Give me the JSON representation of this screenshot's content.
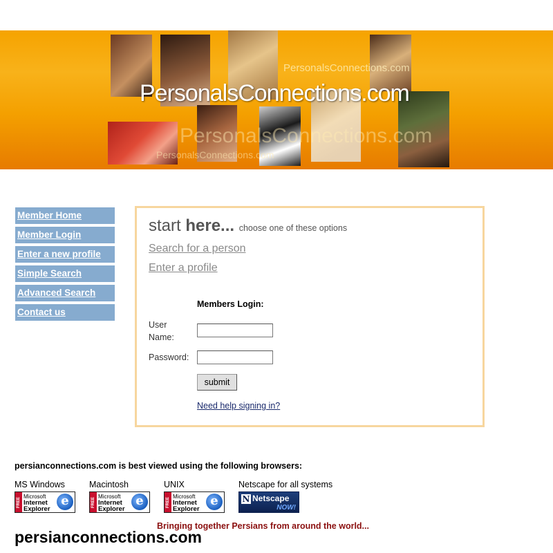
{
  "banner": {
    "logo_main": "PersonalsConnections.com",
    "logo_ghost_small": "PersonalsConnections.com",
    "logo_ghost_large": "PersonalsConnections.com",
    "logo_ghost_bottom": "PersonalsConnections.com"
  },
  "nav": {
    "items": [
      {
        "label": "Member Home"
      },
      {
        "label": "Member Login"
      },
      {
        "label": "Enter a new profile"
      },
      {
        "label": "Simple Search"
      },
      {
        "label": "Advanced Search"
      },
      {
        "label": "Contact us"
      }
    ]
  },
  "main": {
    "start_prefix": "start ",
    "start_bold": "here...",
    "start_sub": "choose one of these options",
    "options": [
      {
        "label": "Search for a person"
      },
      {
        "label": "Enter a profile"
      }
    ],
    "login": {
      "title": "Members Login:",
      "username_label": "User Name:",
      "password_label": "Password:",
      "username_value": "",
      "password_value": "",
      "submit_label": "submit",
      "help_link": "Need help signing in?"
    }
  },
  "footer": {
    "best_viewed": "persianconnections.com is best viewed using the following browsers:",
    "browsers": [
      {
        "os": "MS Windows",
        "badge": "ie"
      },
      {
        "os": "Macintosh",
        "badge": "ie"
      },
      {
        "os": "UNIX",
        "badge": "ie"
      },
      {
        "os": "Netscape for all systems",
        "badge": "netscape"
      }
    ],
    "ie_badge": {
      "free": "FREE",
      "line1": "Microsoft",
      "line2": "Internet",
      "line3": "Explorer",
      "glyph": "e"
    },
    "netscape_badge": {
      "glyph": "N",
      "name": "Netscape",
      "now": "NOW!"
    },
    "tagline": "Bringing together Persians from around the world...",
    "domain": "persianconnections.com"
  },
  "colors": {
    "nav_bg": "#86abcf",
    "box_border": "#f7d69e",
    "tagline": "#8b1010",
    "banner_orange": "#f6a300"
  }
}
